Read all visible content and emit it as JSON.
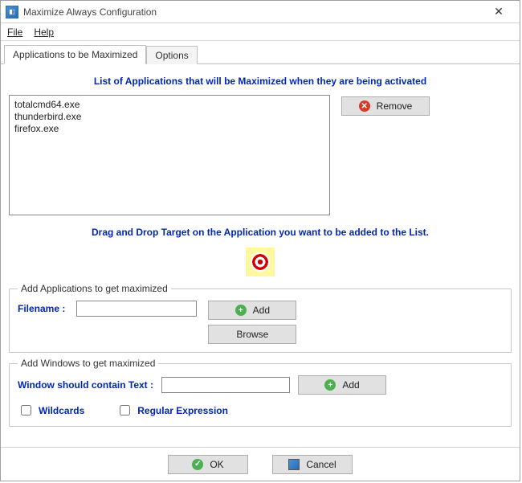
{
  "titlebar": {
    "title": "Maximize Always Configuration"
  },
  "menu": {
    "file": "File",
    "help": "Help"
  },
  "tabs": {
    "apps": "Applications to be Maximized",
    "options": "Options"
  },
  "headings": {
    "list": "List of Applications that will be Maximized when they are being activated",
    "drag": "Drag and Drop Target on the Application you want to be added to the List."
  },
  "applist": [
    "totalcmd64.exe",
    "thunderbird.exe",
    "firefox.exe"
  ],
  "buttons": {
    "remove": "Remove",
    "add": "Add",
    "browse": "Browse",
    "add2": "Add",
    "ok": "OK",
    "cancel": "Cancel"
  },
  "fieldsets": {
    "fs1_legend": "Add Applications to get maximized",
    "fs1_label": "Filename  :",
    "fs1_value": "",
    "fs2_legend": "Add Windows to get maximized",
    "fs2_label": "Window should contain Text :",
    "fs2_value": "",
    "chk_wildcards": "Wildcards",
    "chk_regex": "Regular Expression"
  }
}
